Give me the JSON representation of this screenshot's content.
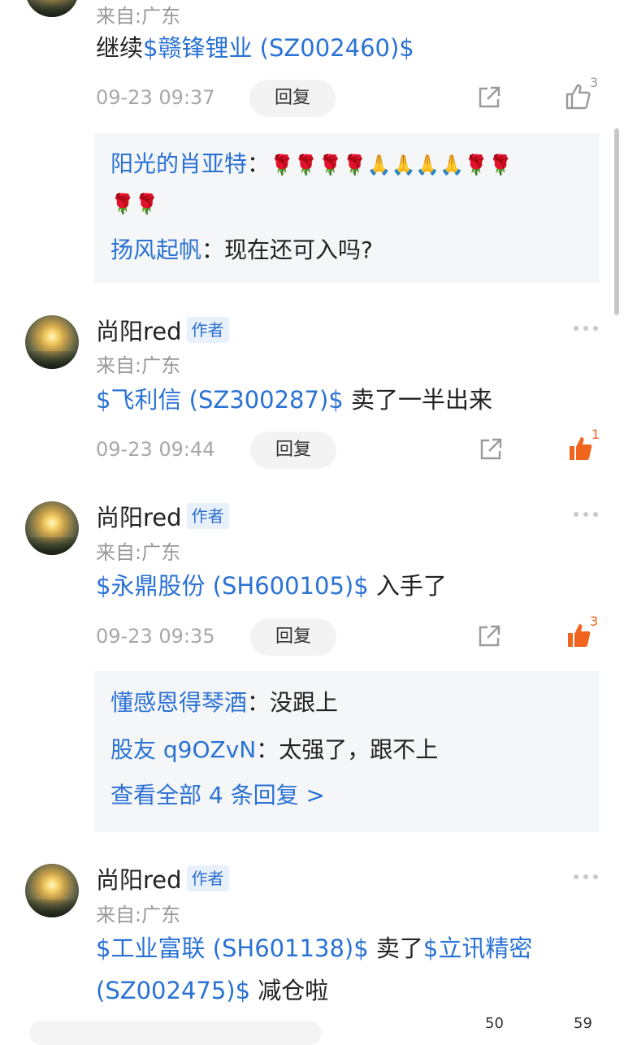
{
  "comment0": {
    "location": "来自:广东",
    "text_prefix": "继续",
    "stock_link": "$赣锋锂业 (SZ002460)$",
    "time": "09-23 09:37",
    "reply_label": "回复",
    "like_count": "3",
    "replies": [
      {
        "user": "阳光的肖亚特",
        "sep": "：",
        "emoji_line1": "🌹🌹🌹🌹🙏🙏🙏🙏🌹🌹",
        "emoji_line2": "🌹🌹"
      },
      {
        "user": "扬风起帆",
        "sep": "：",
        "text": "现在还可入吗?"
      }
    ]
  },
  "comment1": {
    "author": "尚阳red",
    "author_tag": "作者",
    "location": "来自:广东",
    "stock_link": "$飞利信 (SZ300287)$",
    "text_suffix": " 卖了一半出来",
    "time": "09-23 09:44",
    "reply_label": "回复",
    "like_count": "1",
    "liked": true
  },
  "comment2": {
    "author": "尚阳red",
    "author_tag": "作者",
    "location": "来自:广东",
    "stock_link": "$永鼎股份 (SH600105)$",
    "text_suffix": " 入手了",
    "time": "09-23 09:35",
    "reply_label": "回复",
    "like_count": "3",
    "liked": true,
    "replies": [
      {
        "user": "懂感恩得琴酒",
        "sep": "：",
        "text": "没跟上"
      },
      {
        "user": "股友 q9OZvN",
        "sep": "：",
        "text": "太强了，跟不上"
      }
    ],
    "view_all": "查看全部 4 条回复 >"
  },
  "comment3": {
    "author": "尚阳red",
    "author_tag": "作者",
    "location": "来自:广东",
    "stock_link1": "$工业富联 (SH601138)$",
    "text_mid": " 卖了",
    "stock_link2": "$立讯精密",
    "stock_link2_code": "(SZ002475)$",
    "text_suffix": " 减仓啦"
  },
  "bottom_bar": {
    "count1": "50",
    "count2": "59"
  },
  "colors": {
    "link": "#2a72d4",
    "liked": "#f0641e",
    "muted": "#a8a8a8"
  },
  "icons": [
    "share-icon",
    "thumbs-up-icon",
    "more-icon"
  ]
}
